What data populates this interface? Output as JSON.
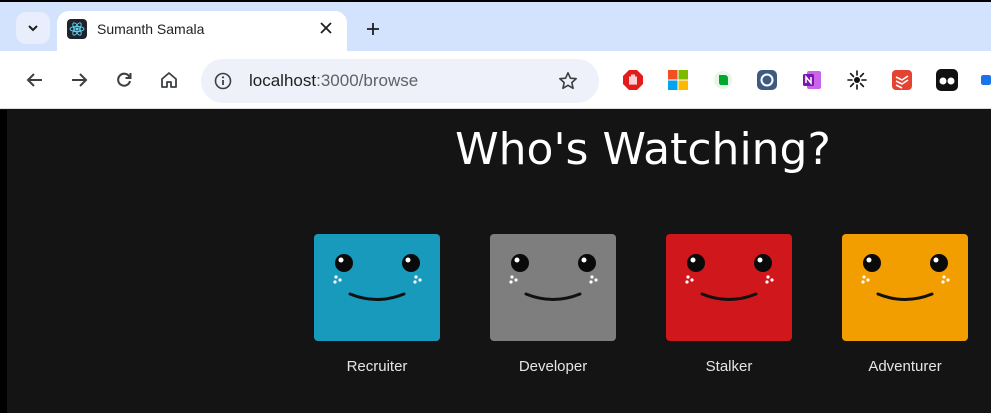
{
  "tab": {
    "title": "Sumanth Samala"
  },
  "omnibox": {
    "host": "localhost",
    "path": ":3000/browse"
  },
  "icons": {
    "tab_search": "chevron-down-icon",
    "favicon": "react-icon",
    "close": "close-icon",
    "new_tab": "plus-icon",
    "back": "arrow-left-icon",
    "forward": "arrow-right-icon",
    "reload": "reload-icon",
    "home": "home-icon",
    "site_info": "info-icon",
    "bookmark": "star-icon",
    "extensions": [
      "stop-hand-icon",
      "microsoft-icon",
      "evernote-icon",
      "camera-icon",
      "onenote-icon",
      "sunburst-icon",
      "todoist-icon",
      "glasses-icon"
    ]
  },
  "main": {
    "heading": "Who's Watching?",
    "profiles": [
      {
        "name": "Recruiter",
        "color": "#1aa3c4"
      },
      {
        "name": "Developer",
        "color": "#8a8a8a"
      },
      {
        "name": "Stalker",
        "color": "#e11b1f"
      },
      {
        "name": "Adventurer",
        "color": "#f9a800"
      }
    ]
  },
  "colors": {
    "background": "#141414",
    "tabstrip": "#d3e3fd",
    "text": "#ffffff"
  }
}
